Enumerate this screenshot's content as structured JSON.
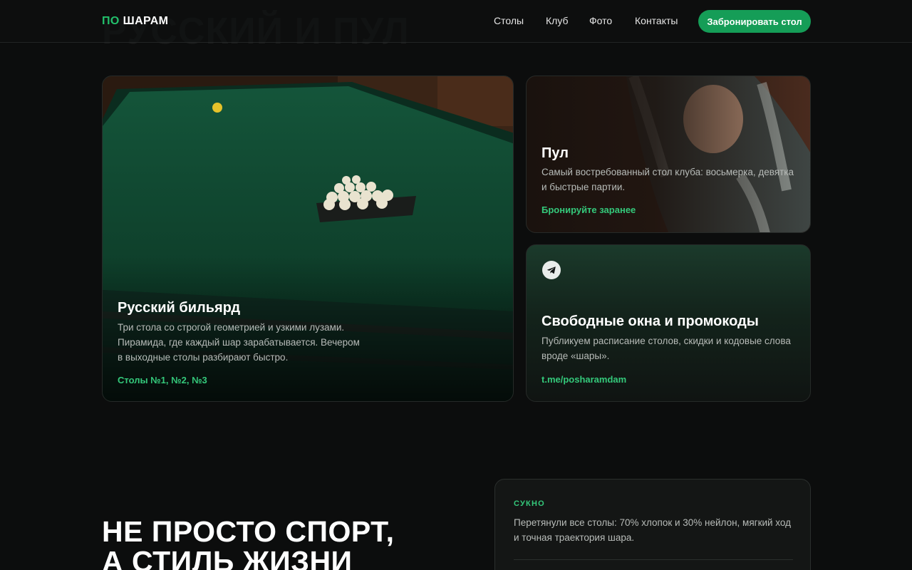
{
  "header": {
    "logo_left": "ПО",
    "logo_right": "ШАРАМ",
    "ghost_title": "РУССКИЙ И ПУЛ",
    "nav": [
      "Столы",
      "Клуб",
      "Фото",
      "Контакты"
    ],
    "cta_label": "Забронировать стол"
  },
  "cards": {
    "russian": {
      "title": "Русский бильярд",
      "text": "Три стола со строгой геометрией и узкими лузами. Пирамида, где каждый шар зарабатывается. Вечером в выходные столы разбирают быстро.",
      "link": "Столы №1, №2, №3"
    },
    "pool": {
      "title": "Пул",
      "text": "Самый востребованный стол клуба: восьмерка, девятка и быстрые партии.",
      "link": "Бронируйте заранее"
    },
    "telegram": {
      "icon": "telegram-icon",
      "title": "Свободные окна и промокоды",
      "text": "Публикуем расписание столов, скидки и кодовые слова вроде «шары».",
      "link": "t.me/posharamdam"
    }
  },
  "hero": {
    "line1": "НЕ ПРОСТО СПОРТ,",
    "line2": "А СТИЛЬ ЖИЗНИ"
  },
  "info": {
    "tag": "СУКНО",
    "text": "Перетянули все столы: 70% хлопок и 30% нейлон, мягкий ход и точная траектория шара."
  },
  "colors": {
    "accent": "#159d57",
    "link": "#34c97b",
    "background": "#0c0d0d"
  }
}
